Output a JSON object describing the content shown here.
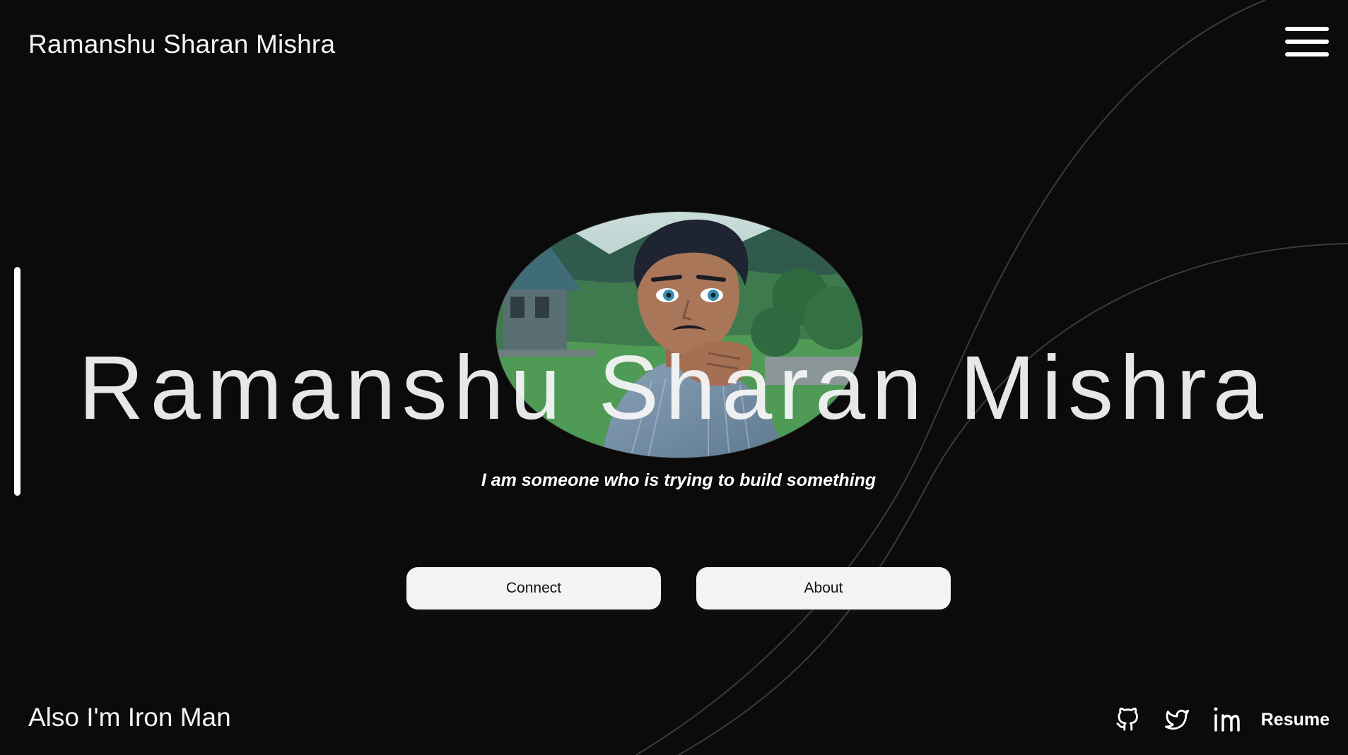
{
  "header": {
    "brand": "Ramanshu Sharan Mishra",
    "menu_icon": "hamburger-menu-icon"
  },
  "hero": {
    "name": "Ramanshu Sharan Mishra",
    "tagline": "I am someone who is trying to build something",
    "portrait": "anime-style-portrait-image"
  },
  "actions": {
    "connect_label": "Connect",
    "about_label": "About"
  },
  "footer": {
    "quote": "Also I'm Iron Man",
    "socials": [
      {
        "icon": "github-icon"
      },
      {
        "icon": "twitter-icon"
      },
      {
        "icon": "linkedin-icon"
      }
    ],
    "resume_label": "Resume"
  },
  "colors": {
    "background": "#0b0b0b",
    "text": "#f4f4f4",
    "button_bg": "#f3f3f3",
    "button_text": "#111111"
  }
}
